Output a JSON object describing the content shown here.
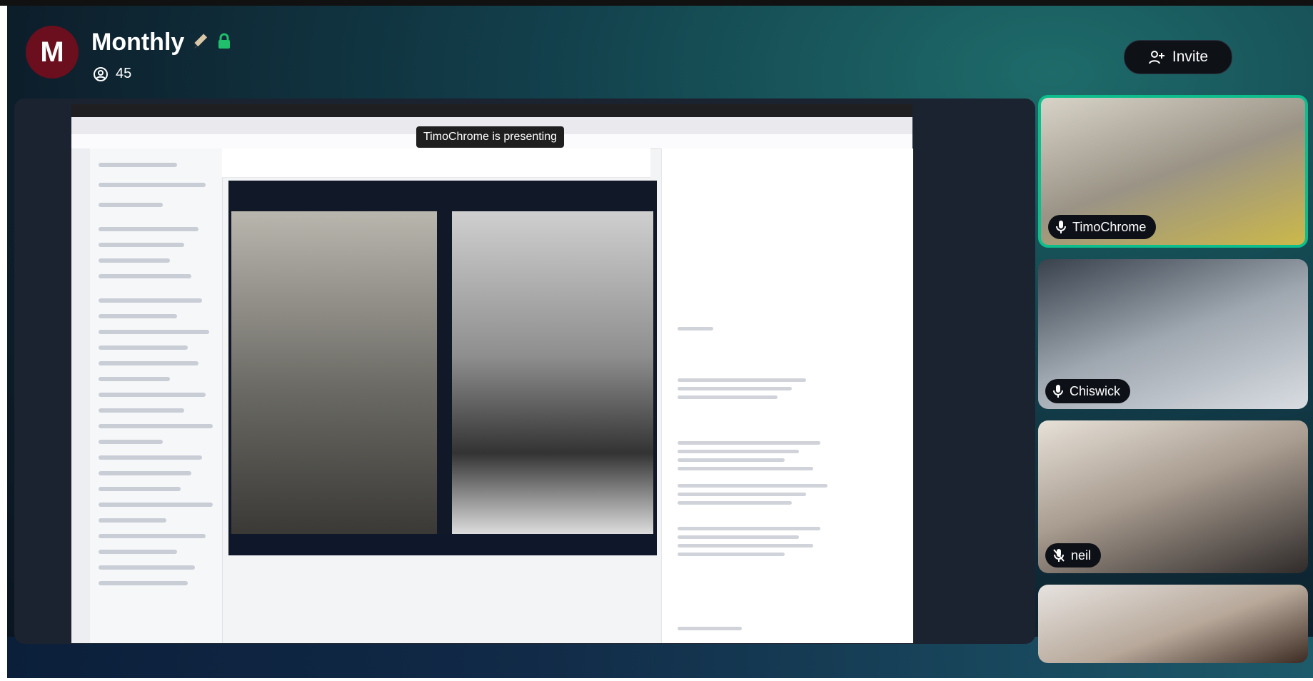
{
  "room": {
    "avatar_letter": "M",
    "title": "Monthly",
    "member_count": "45",
    "invite_label": "Invite"
  },
  "stage": {
    "presenting_label": "TimoChrome is presenting"
  },
  "participants": [
    {
      "name": "TimoChrome",
      "muted": false
    },
    {
      "name": "Chiswick",
      "muted": false
    },
    {
      "name": "neil",
      "muted": true
    },
    {
      "name": "",
      "muted": false
    }
  ],
  "colors": {
    "active_speaker_border": "#0dbd8b",
    "avatar_bg": "#6b0f1e",
    "lock_green": "#1fbf6b"
  }
}
